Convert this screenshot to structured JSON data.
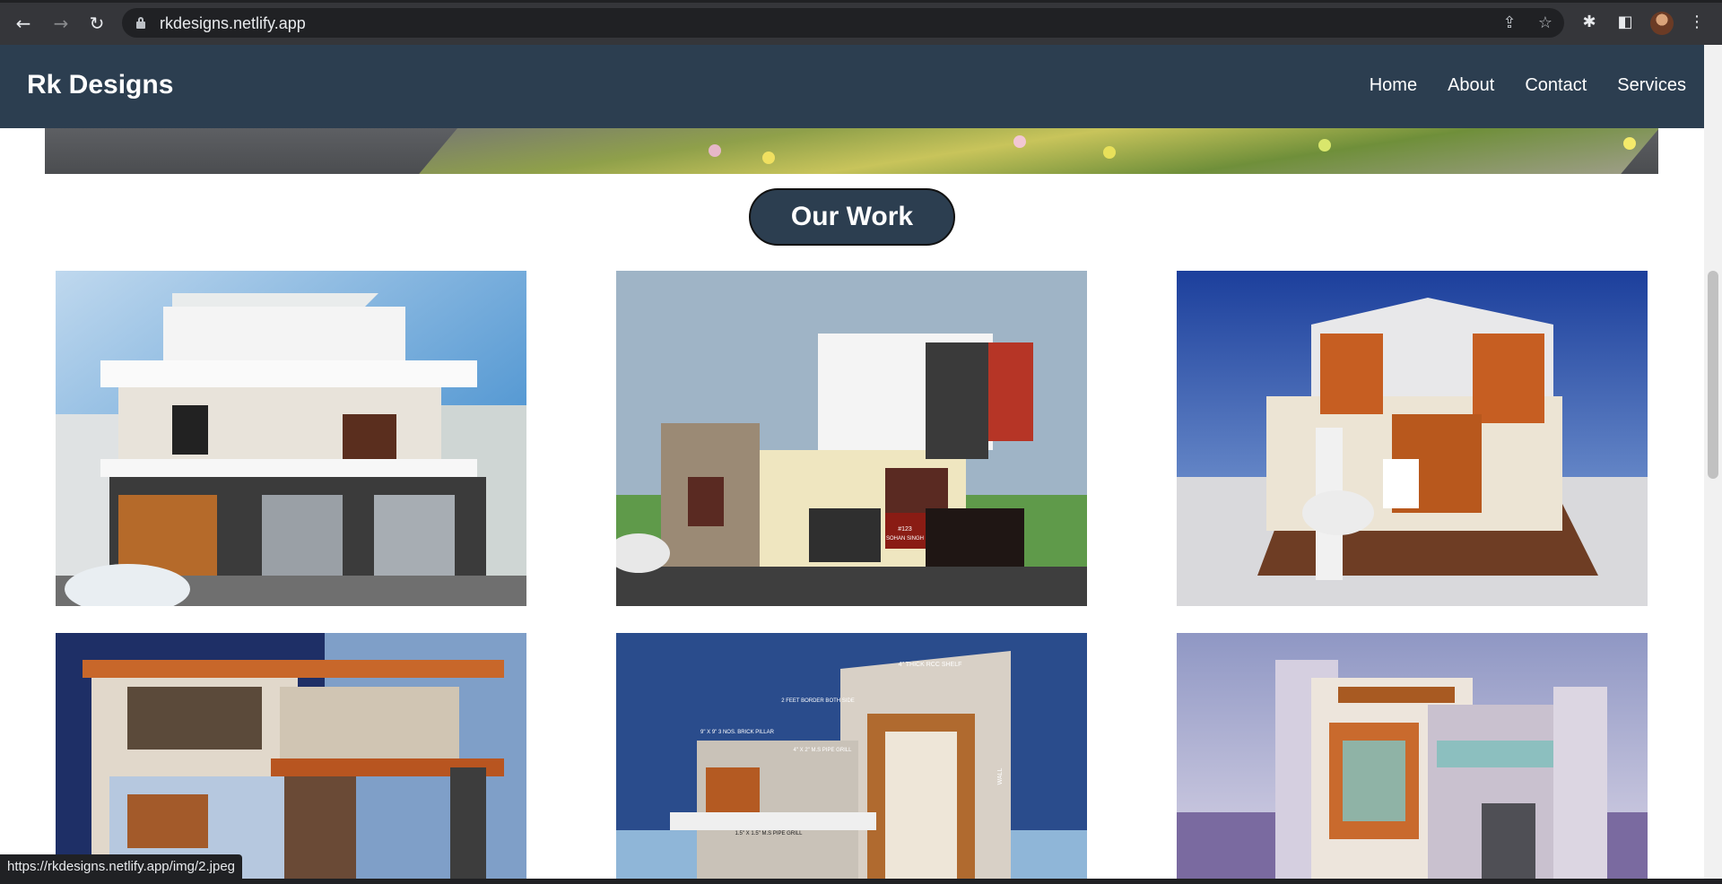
{
  "browser": {
    "url": "rkdesigns.netlify.app",
    "status_url": "https://rkdesigns.netlify.app/img/2.jpeg",
    "icons": [
      "back-arrow-icon",
      "forward-arrow-icon",
      "reload-icon",
      "lock-icon",
      "share-icon",
      "star-icon",
      "puzzle-icon",
      "side-panel-icon",
      "profile-avatar",
      "kebab-menu-icon"
    ]
  },
  "site": {
    "brand": "Rk Designs",
    "nav": [
      "Home",
      "About",
      "Contact",
      "Services"
    ]
  },
  "section": {
    "title": "Our Work"
  },
  "gallery": [
    {
      "label_sign": ""
    },
    {
      "label_sign": "#123 SOHAN SINGH"
    },
    {
      "label_sign": ""
    },
    {
      "label_sign": ""
    },
    {
      "annotations": [
        "4\" THICK RCC SHELF",
        "2 FEET BORDER BOTH SIDE",
        "9\" X 9\" 3 NOS. BRICK PILLAR",
        "4\" X 2\" M.S PIPE GRILL",
        "1.5\" X 1.5\" M.S PIPE GRILL",
        "WALL"
      ]
    },
    {
      "label_sign": ""
    }
  ],
  "colors": {
    "header": "#2c3e50",
    "pill": "#2c3e50"
  }
}
